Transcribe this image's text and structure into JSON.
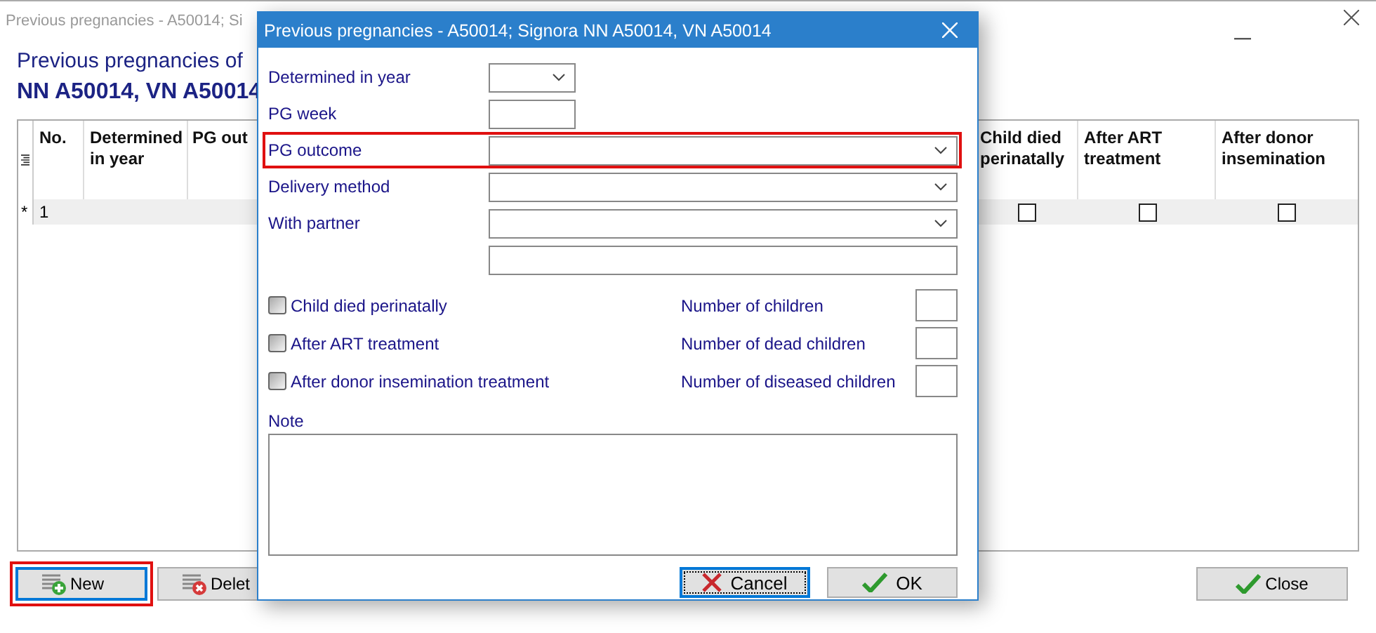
{
  "main_window": {
    "title": "Previous pregnancies - A50014; Si",
    "heading": "Previous pregnancies of",
    "patient": "NN A50014, VN A50014",
    "table": {
      "columns": [
        "No.",
        "Determined in year",
        "PG out",
        "Child died perinatally",
        "After ART treatment",
        "After donor insemination"
      ],
      "rows": [
        {
          "marker": "*",
          "no": "1",
          "child_died": false,
          "after_art": false,
          "after_donor": false
        }
      ]
    },
    "buttons": [
      {
        "kind": "new",
        "label": "New",
        "focused": true,
        "highlighted": true
      },
      {
        "kind": "delete",
        "label": "Delet",
        "focused": false,
        "highlighted": false
      },
      {
        "kind": "close",
        "label": "Close",
        "focused": false,
        "highlighted": false
      }
    ]
  },
  "dialog": {
    "title": "Previous pregnancies - A50014; Signora NN A50014, VN A50014",
    "fields": [
      {
        "kind": "short-select",
        "label": "Determined in year",
        "highlighted": false
      },
      {
        "kind": "short-input",
        "label": "PG week",
        "highlighted": false
      },
      {
        "kind": "select",
        "label": "PG outcome",
        "highlighted": true
      },
      {
        "kind": "select",
        "label": "Delivery method",
        "highlighted": false
      },
      {
        "kind": "select",
        "label": "With partner",
        "highlighted": false
      },
      {
        "kind": "input",
        "highlighted": false
      }
    ],
    "checkboxes": [
      {
        "label": "Child died perinatally",
        "checked": false
      },
      {
        "label": "After ART treatment",
        "checked": false
      },
      {
        "label": "After donor insemination treatment",
        "checked": false
      }
    ],
    "counts": [
      {
        "label": "Number of children"
      },
      {
        "label": "Number of dead children"
      },
      {
        "label": "Number of diseased children"
      }
    ],
    "note": {
      "label": "Note"
    },
    "buttons": [
      {
        "kind": "cancel",
        "label": "Cancel",
        "focused": true
      },
      {
        "kind": "ok",
        "label": "OK",
        "focused": false
      }
    ]
  }
}
